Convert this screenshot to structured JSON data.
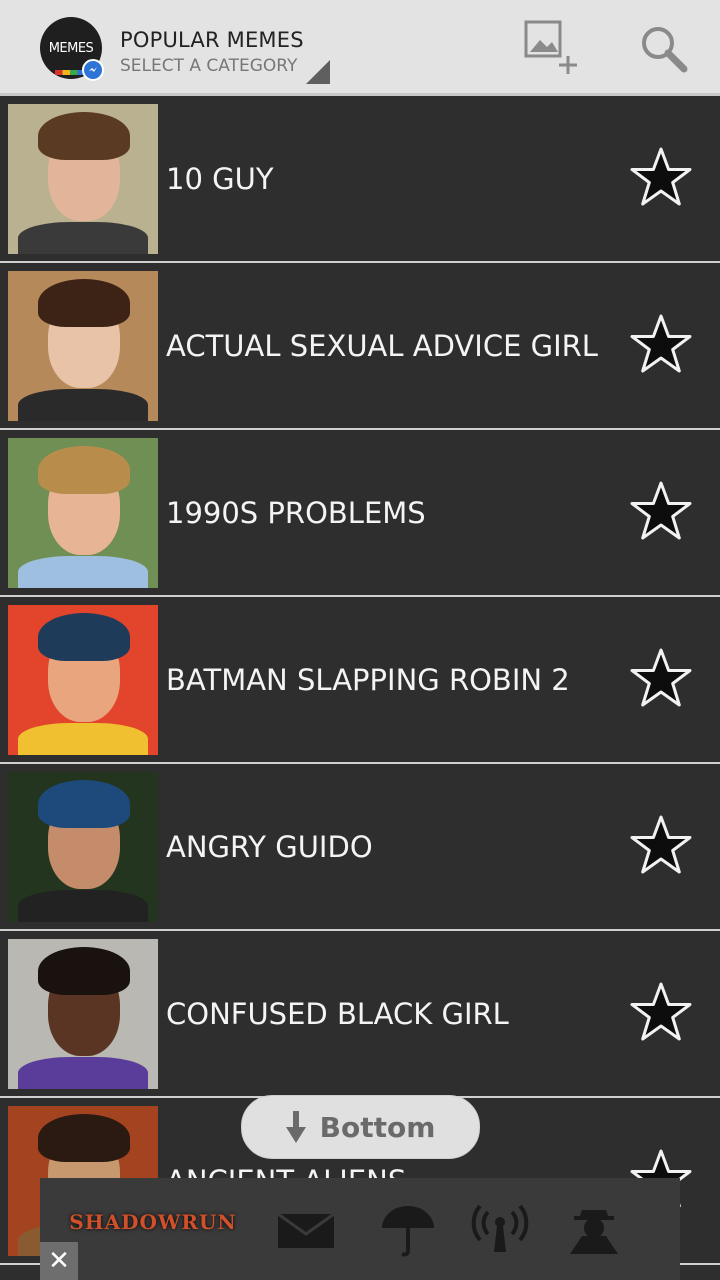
{
  "header": {
    "logo_text": "MEMES",
    "title": "POPULAR MEMES",
    "subtitle": "SELECT A CATEGORY",
    "add_image_icon": "add-image-icon",
    "search_icon": "search-icon"
  },
  "memes": [
    {
      "label": "10 GUY",
      "thumb": {
        "bg": "#b9b18f",
        "skin": "#e2b59b",
        "hair": "#5a3a22",
        "shirt": "#3a3a3a"
      }
    },
    {
      "label": "ACTUAL SEXUAL ADVICE GIRL",
      "thumb": {
        "bg": "#b5895a",
        "skin": "#e8c3a8",
        "hair": "#3d2316",
        "shirt": "#2a2a2a"
      }
    },
    {
      "label": "1990S PROBLEMS",
      "thumb": {
        "bg": "#6f8f55",
        "skin": "#e7b596",
        "hair": "#b88d4c",
        "shirt": "#9fbfe0"
      }
    },
    {
      "label": "BATMAN SLAPPING ROBIN 2",
      "thumb": {
        "bg": "#e2452c",
        "skin": "#e9a57e",
        "hair": "#1e3b5a",
        "shirt": "#f0c030"
      }
    },
    {
      "label": "ANGRY GUIDO",
      "thumb": {
        "bg": "#23351e",
        "skin": "#c58c6b",
        "hair": "#1d4a7a",
        "shirt": "#222222"
      }
    },
    {
      "label": "CONFUSED BLACK GIRL",
      "thumb": {
        "bg": "#b9b8b3",
        "skin": "#5a3524",
        "hair": "#1a120e",
        "shirt": "#5a3c9a"
      }
    },
    {
      "label": "ANCIENT ALIENS",
      "thumb": {
        "bg": "#a4431f",
        "skin": "#c7976e",
        "hair": "#2b1a12",
        "shirt": "#8a5a30"
      }
    }
  ],
  "bottom_button": {
    "label": "Bottom"
  },
  "ad": {
    "brand": "SHADOWRUN",
    "icons": [
      "mail-icon",
      "umbrella-icon",
      "broadcast-icon",
      "spy-icon"
    ],
    "close": "✕"
  },
  "colors": {
    "header_bg": "#e3e3e3",
    "list_bg": "#2e2e2e",
    "divider": "#d0d0d0",
    "text": "#f4f4f4"
  }
}
